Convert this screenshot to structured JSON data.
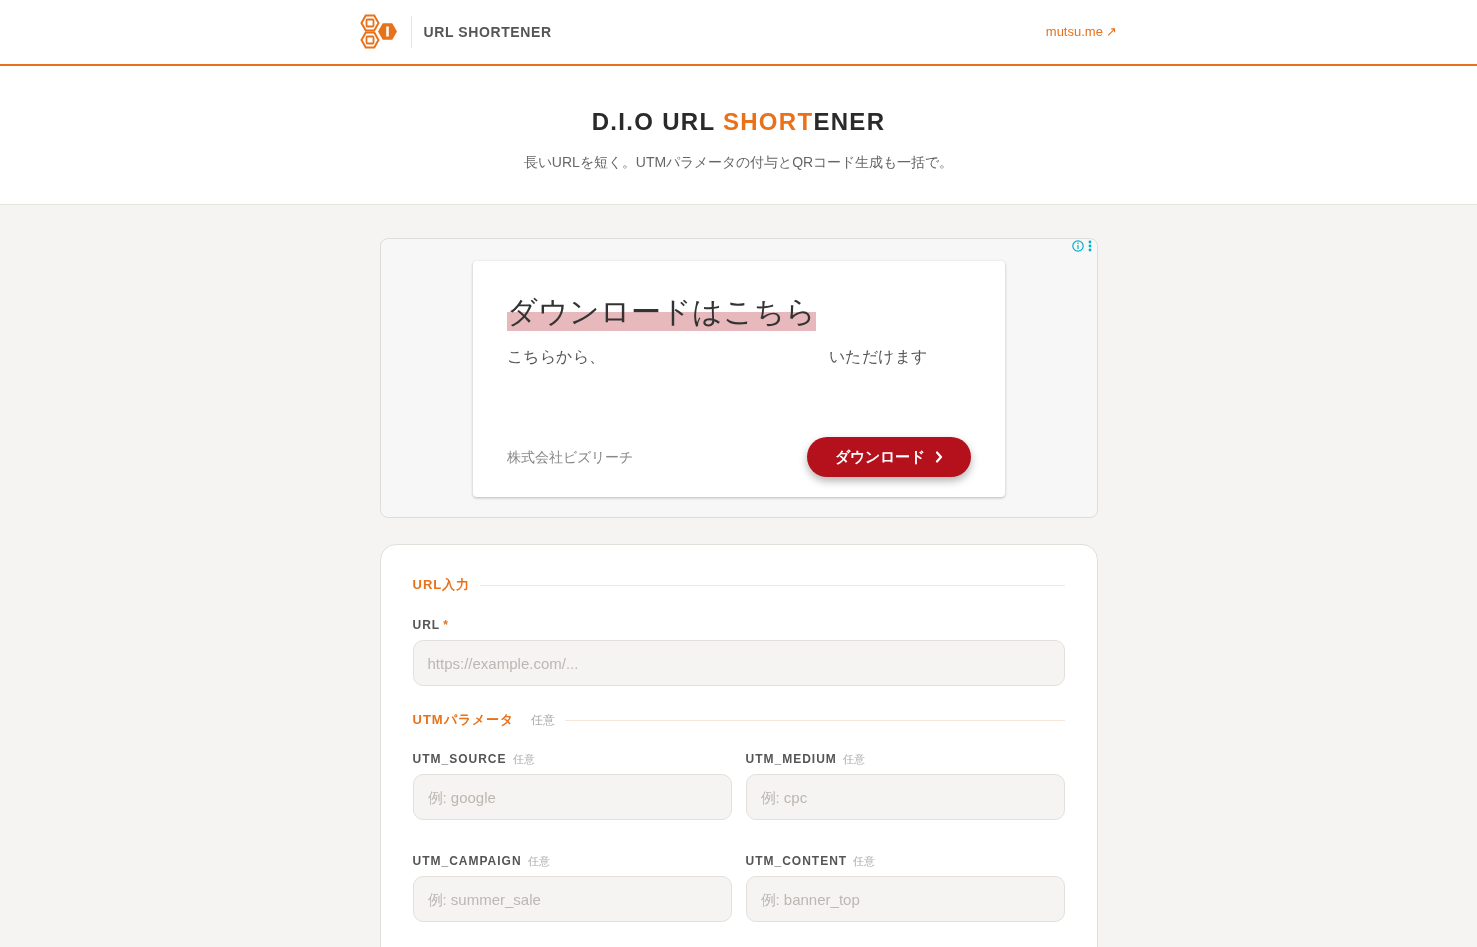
{
  "header": {
    "title": "URL SHORTENER",
    "link": "mutsu.me ↗"
  },
  "hero": {
    "title_parts": [
      {
        "text": "D.I.O URL ",
        "accent": false
      },
      {
        "text": "SHORT",
        "accent": true
      },
      {
        "text": "ENER",
        "accent": false
      }
    ],
    "subtitle": "長いURLを短く。UTMパラメータの付与とQRコード生成も一括で。"
  },
  "ad": {
    "headline": "ダウンロードはこちら",
    "body": [
      "こちらから、",
      "いただけます"
    ],
    "advertiser": "株式会社ビズリーチ",
    "button": "ダウンロード"
  },
  "form": {
    "sections": [
      {
        "kind": "stack",
        "title": "URL入力",
        "fields": [
          {
            "label": "URL",
            "required_mark": "*",
            "placeholder": "https://example.com/..."
          }
        ]
      },
      {
        "kind": "grid",
        "title": "UTMパラメータ",
        "note": "任意",
        "fields": [
          {
            "label": "UTM_SOURCE",
            "note": "任意",
            "placeholder": "例: google"
          },
          {
            "label": "UTM_MEDIUM",
            "note": "任意",
            "placeholder": "例: cpc"
          },
          {
            "label": "UTM_CAMPAIGN",
            "note": "任意",
            "placeholder": "例: summer_sale"
          },
          {
            "label": "UTM_CONTENT",
            "note": "任意",
            "placeholder": "例: banner_top"
          }
        ]
      }
    ]
  }
}
